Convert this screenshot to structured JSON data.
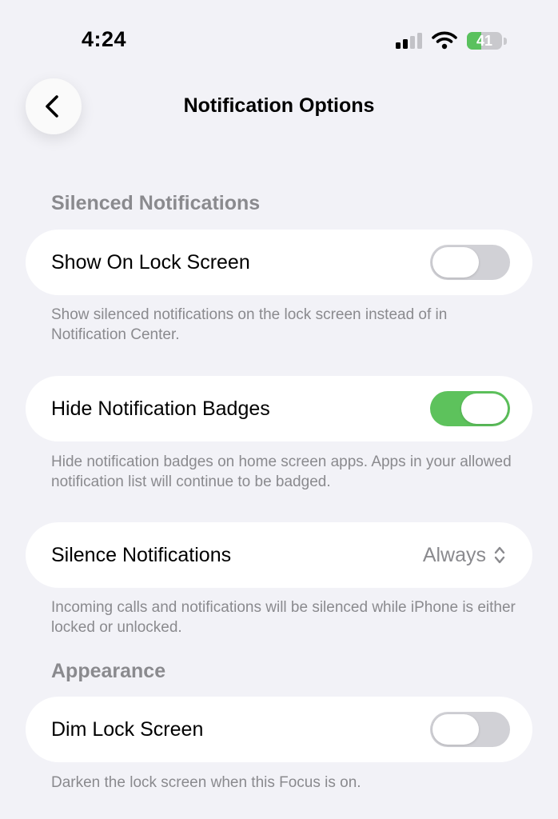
{
  "status_bar": {
    "time": "4:24",
    "battery_percent": 41,
    "battery_text": "41"
  },
  "nav": {
    "title": "Notification Options",
    "back_icon": "chevron-left-icon"
  },
  "sections": {
    "silenced_notifications": {
      "header": "Silenced Notifications",
      "show_on_lock_screen": {
        "label": "Show On Lock Screen",
        "enabled": false,
        "footer": "Show silenced notifications on the lock screen instead of in Notification Center."
      },
      "hide_notification_badges": {
        "label": "Hide Notification Badges",
        "enabled": true,
        "footer": "Hide notification badges on home screen apps. Apps in your allowed notification list will continue to be badged."
      },
      "silence_notifications": {
        "label": "Silence Notifications",
        "value": "Always",
        "footer": "Incoming calls and notifications will be silenced while iPhone is either locked or unlocked."
      }
    },
    "appearance": {
      "header": "Appearance",
      "dim_lock_screen": {
        "label": "Dim Lock Screen",
        "enabled": false,
        "footer": "Darken the lock screen when this Focus is on."
      }
    }
  },
  "colors": {
    "background": "#f2f2f7",
    "toggle_on": "#5dc25c",
    "toggle_off": "#d1d1d6",
    "secondary_text": "#8a8a8e",
    "battery_fill": "#5ac15e"
  }
}
